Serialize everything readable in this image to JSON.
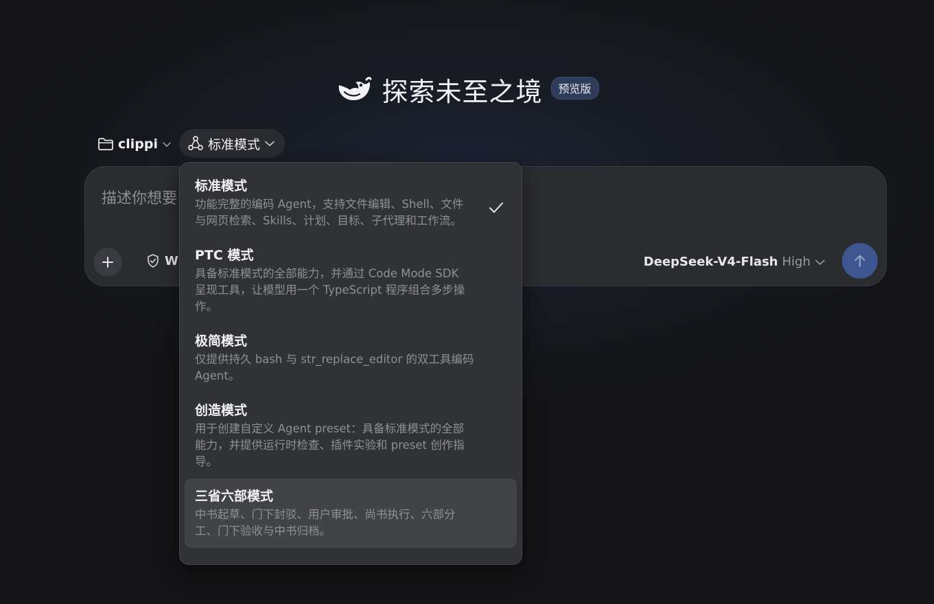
{
  "hero": {
    "title": "探索未至之境",
    "badge": "预览版",
    "logo_icon": "whale-logo-icon"
  },
  "project": {
    "label": "clippi",
    "icon": "folder-icon"
  },
  "mode_selector": {
    "label": "标准模式",
    "icon": "mode-network-icon"
  },
  "composer": {
    "placeholder": "描述你想要",
    "web_label": "W",
    "model_name": "DeepSeek-V4-Flash",
    "effort": "High"
  },
  "dropdown": {
    "options": [
      {
        "title": "标准模式",
        "desc_lines": [
          "功能完整的编码 Agent，支持文件编辑、Shell、文件",
          "与网页检索、Skills、计划、目标、子代理和工作流。"
        ],
        "selected": true
      },
      {
        "title": "PTC 模式",
        "desc_lines": [
          "具备标准模式的全部能力，并通过 Code Mode SDK",
          "呈现工具，让模型用一个 TypeScript 程序组合多步操",
          "作。"
        ],
        "selected": false
      },
      {
        "title": "极简模式",
        "desc_lines": [
          "仅提供持久 bash 与 str_replace_editor 的双工具编码",
          "Agent。"
        ],
        "selected": false
      },
      {
        "title": "创造模式",
        "desc_lines": [
          "用于创建自定义 Agent preset：具备标准模式的全部",
          "能力，并提供运行时检查、插件实验和 preset 创作指",
          "导。"
        ],
        "selected": false
      },
      {
        "title": "三省六部模式",
        "desc_lines": [
          "中书起草、门下封驳、用户审批、尚书执行、六部分",
          "工、门下验收与中书归档。"
        ],
        "selected": false,
        "hovered": true
      }
    ]
  },
  "colors": {
    "accent": "#3e5690",
    "badge_bg": "#2e3c5a",
    "menu_bg": "#313236"
  }
}
